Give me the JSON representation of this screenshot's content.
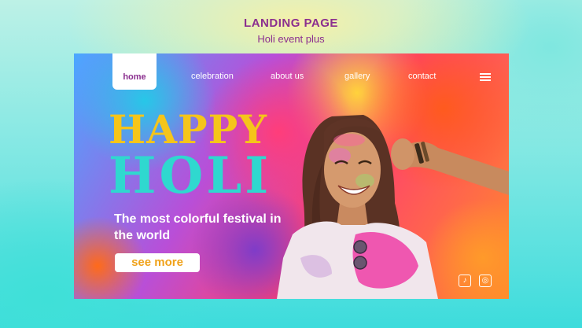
{
  "header": {
    "title": "LANDING PAGE",
    "subtitle": "Holi event plus"
  },
  "nav": {
    "items": [
      "home",
      "celebration",
      "about us",
      "gallery",
      "contact"
    ],
    "menu_icon": "hamburger-menu-icon"
  },
  "hero": {
    "headline_line1": "HAPPY",
    "headline_line2": "HOLI",
    "tagline": "The most colorful festival in the world",
    "cta_label": "see more"
  },
  "social": {
    "icons": [
      "tiktok-icon",
      "instagram-icon"
    ],
    "tiktok_glyph": "♪",
    "instagram_glyph": "◎"
  },
  "colors": {
    "accent_purple": "#8b2f8f",
    "happy_yellow": "#f5c51a",
    "holi_teal": "#2fd8cf",
    "cta_text": "#f0a21a"
  }
}
